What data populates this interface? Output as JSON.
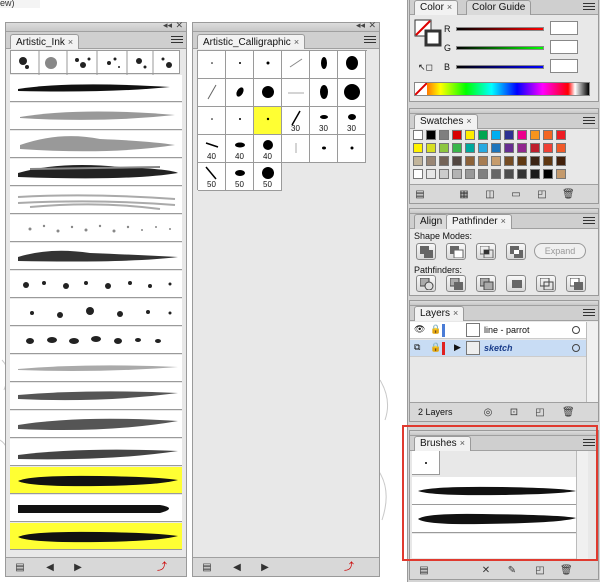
{
  "artistic_ink": {
    "tab_label": "Artistic_Ink",
    "close": "×"
  },
  "artistic_calligraphic": {
    "tab_label": "Artistic_Calligraphic",
    "close": "×",
    "grid": [
      [
        "",
        "",
        "",
        "",
        "",
        ""
      ],
      [
        "",
        "",
        "",
        "",
        "",
        ""
      ],
      [
        "",
        "",
        "",
        "30",
        "30",
        "30"
      ],
      [
        "40",
        "40",
        "40",
        "",
        "",
        ""
      ],
      [
        "50",
        "50",
        "50"
      ]
    ]
  },
  "color": {
    "tab_color": "Color",
    "tab_guide": "Color Guide",
    "close": "×",
    "channels": [
      "R",
      "G",
      "B"
    ]
  },
  "swatches": {
    "tab_label": "Swatches",
    "close": "×",
    "colors": [
      [
        "#ffffff",
        "#000000",
        "#7f7f7f",
        "#d90000",
        "#ffed00",
        "#00a651",
        "#00aeef",
        "#2e3192",
        "#ec008c",
        "#f7941d",
        "#f26522",
        "#ed1c24"
      ],
      [
        "#fff200",
        "#d7df23",
        "#8dc63f",
        "#39b54a",
        "#00a99d",
        "#27aae1",
        "#1c75bc",
        "#662d91",
        "#92278f",
        "#be1e2d",
        "#ef4136",
        "#f15a29"
      ],
      [
        "#c2b59b",
        "#998675",
        "#736357",
        "#534741",
        "#8c6239",
        "#a67c52",
        "#c69c6d",
        "#754c24",
        "#603913",
        "#3c2415",
        "#603813",
        "#42210b"
      ],
      [
        "#ffffff",
        "#e6e6e6",
        "#cccccc",
        "#b3b3b3",
        "#999999",
        "#808080",
        "#666666",
        "#4d4d4d",
        "#333333",
        "#1a1a1a",
        "#000000",
        "#c49a6c"
      ]
    ]
  },
  "pathfinder": {
    "tab_align": "Align",
    "tab_pathfinder": "Pathfinder",
    "close": "×",
    "shape_modes_label": "Shape Modes:",
    "expand_label": "Expand",
    "pathfinders_label": "Pathfinders:"
  },
  "layers": {
    "tab_label": "Layers",
    "close": "×",
    "rows": [
      {
        "name": "line - parrot",
        "selected": false,
        "color": "#4a7cd6"
      },
      {
        "name": "sketch",
        "selected": true,
        "color": "#e02020"
      }
    ],
    "count_label": "2 Layers"
  },
  "brushes": {
    "tab_label": "Brushes",
    "close": "×",
    "highlight_color": "#e03a2f"
  }
}
